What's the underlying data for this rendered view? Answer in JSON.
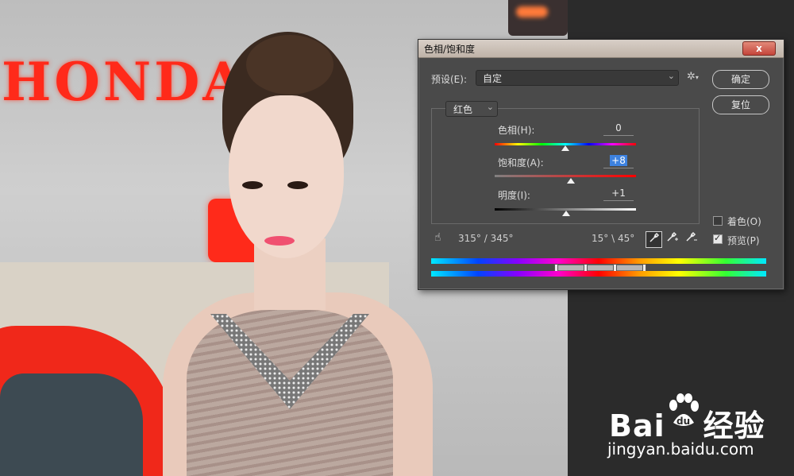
{
  "background": {
    "sign_text": "HONDA",
    "watermark_brand": "Bai",
    "watermark_paw": "du",
    "watermark_cn": "经验",
    "watermark_url": "jingyan.baidu.com"
  },
  "dialog": {
    "title": "色相/饱和度",
    "close_label": "x",
    "preset_label": "预设(E):",
    "preset_value": "自定",
    "ok_label": "确定",
    "reset_label": "复位",
    "channel_value": "红色",
    "hue_label": "色相(H):",
    "hue_value": "0",
    "saturation_label": "饱和度(A):",
    "saturation_value": "+8",
    "lightness_label": "明度(I):",
    "lightness_value": "+1",
    "range_left": "315° / 345°",
    "range_right": "15° \\ 45°",
    "colorize_label": "着色(O)",
    "preview_label": "预览(P)",
    "colorize_checked": false,
    "preview_checked": true,
    "hue_slider": 0,
    "saturation_slider": 8,
    "lightness_slider": 1
  },
  "icons": {
    "gear": "gear-icon",
    "hand": "targeted-adjust-hand-icon",
    "eyedropper": "eyedropper-icon",
    "eyedropper_plus": "eyedropper-plus-icon",
    "eyedropper_minus": "eyedropper-minus-icon"
  }
}
